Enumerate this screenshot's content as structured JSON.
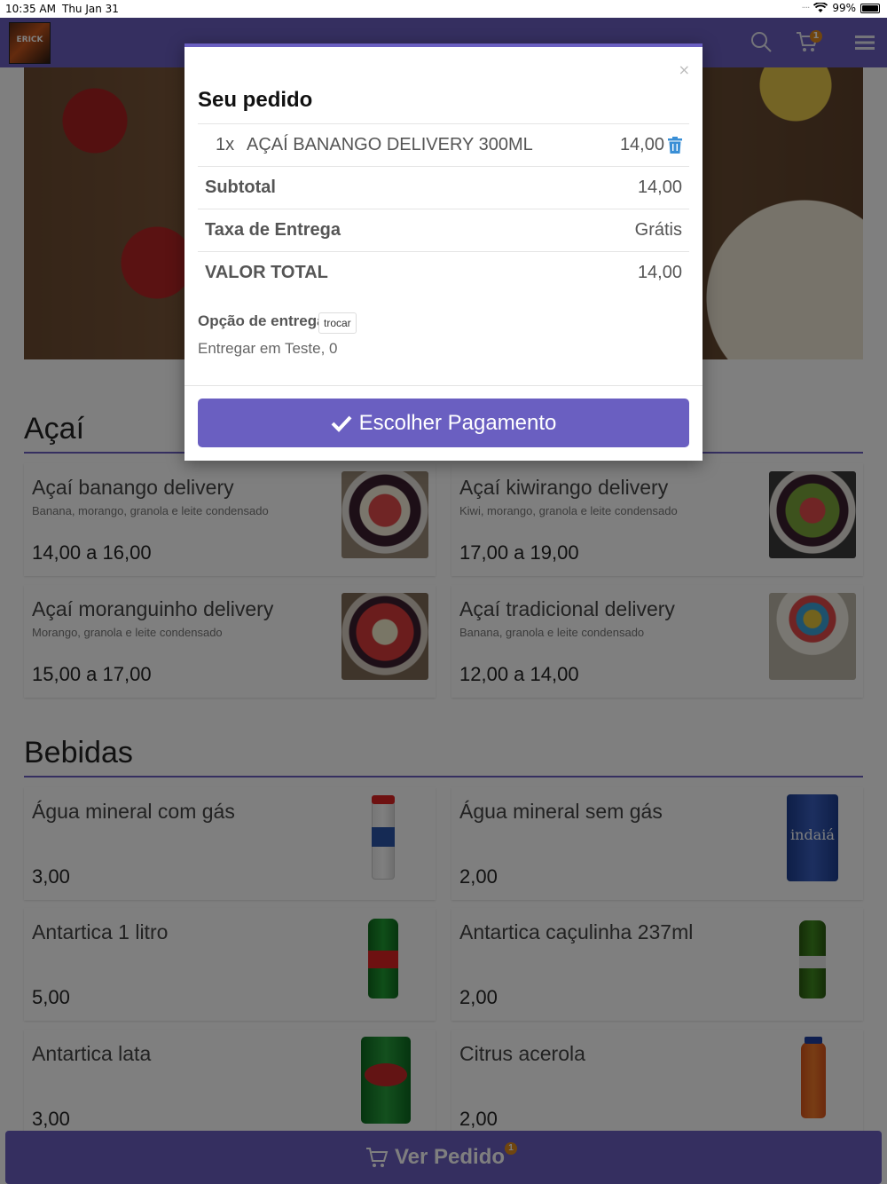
{
  "status_bar": {
    "time": "10:35 AM",
    "date": "Thu Jan 31",
    "battery": "99%"
  },
  "navbar": {
    "logo_text": "ERICK",
    "cart_count": "1",
    "icons": [
      "search-icon",
      "cart-icon",
      "menu-icon"
    ]
  },
  "sections": [
    {
      "title": "Açaí",
      "items": [
        {
          "name": "Açaí banango delivery",
          "desc": "Banana, morango, granola e leite condensado",
          "price": "14,00 a 16,00"
        },
        {
          "name": "Açaí kiwirango delivery",
          "desc": "Kiwi, morango, granola e leite condensado",
          "price": "17,00 a 19,00"
        },
        {
          "name": "Açaí moranguinho delivery",
          "desc": "Morango, granola e leite condensado",
          "price": "15,00 a 17,00"
        },
        {
          "name": "Açaí tradicional delivery",
          "desc": "Banana, granola e leite condensado",
          "price": "12,00 a 14,00"
        }
      ]
    },
    {
      "title": "Bebidas",
      "items": [
        {
          "name": "Água mineral com gás",
          "price": "3,00"
        },
        {
          "name": "Água mineral sem gás",
          "price": "2,00",
          "bottle_text": "indaiá"
        },
        {
          "name": "Antartica 1 litro",
          "price": "5,00"
        },
        {
          "name": "Antartica caçulinha 237ml",
          "price": "2,00"
        },
        {
          "name": "Antartica lata",
          "price": "3,00"
        },
        {
          "name": "Citrus acerola",
          "price": "2,00"
        }
      ]
    }
  ],
  "bottom_bar": {
    "label": "Ver Pedido",
    "count": "1"
  },
  "modal": {
    "close": "×",
    "title": "Seu pedido",
    "item": {
      "qty": "1x",
      "name": "AÇAÍ BANANGO DELIVERY 300ML",
      "price": "14,00"
    },
    "subtotal_label": "Subtotal",
    "subtotal_value": "14,00",
    "fee_label": "Taxa de Entrega",
    "fee_value": "Grátis",
    "total_label": "VALOR TOTAL",
    "total_value": "14,00",
    "delivery_option_label": "Opção de entrega",
    "change_label": "trocar",
    "address": "Entregar em Teste, 0",
    "pay_button": "Escolher Pagamento"
  },
  "colors": {
    "brand": "#6a5fc1",
    "badge": "#e08a1e",
    "trash": "#3a8fd6"
  }
}
